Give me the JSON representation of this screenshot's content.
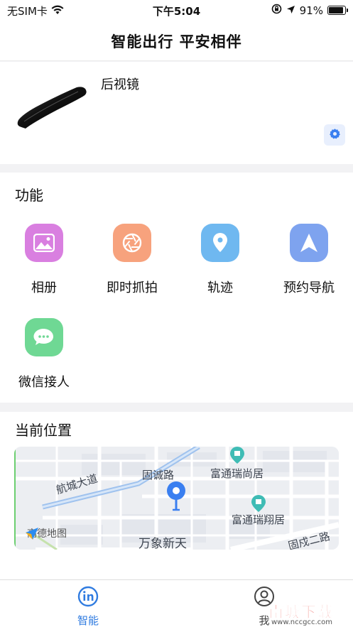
{
  "status_bar": {
    "carrier": "无SIM卡",
    "time": "下午5:04",
    "battery_text": "91%",
    "battery_level": 0.91
  },
  "nav": {
    "title": "智能出行 平安相伴"
  },
  "device": {
    "name": "后视镜"
  },
  "functions": {
    "title": "功能",
    "items": [
      {
        "label": "相册",
        "icon": "photo-icon",
        "color": "#d97fe0"
      },
      {
        "label": "即时抓拍",
        "icon": "shutter-icon",
        "color": "#f7a27d"
      },
      {
        "label": "轨迹",
        "icon": "location-pin-icon",
        "color": "#6fb8f0"
      },
      {
        "label": "预约导航",
        "icon": "navigation-arrow-icon",
        "color": "#7ea3ef"
      },
      {
        "label": "微信接人",
        "icon": "chat-bubble-icon",
        "color": "#6fd894"
      }
    ]
  },
  "location": {
    "title": "当前位置",
    "map": {
      "brand": "高德地图",
      "labels": {
        "hangcheng": "航城大道",
        "gucheng": "固诚路",
        "ruishang": "富通瑞尚居",
        "ruixiang": "富通瑞翔居",
        "wanxiang": "万象新天",
        "guchenger": "固戍二路"
      }
    }
  },
  "tab_bar": {
    "tabs": [
      {
        "label": "智能",
        "icon": "smart-tab-icon",
        "active": true,
        "color": "#2f7be0"
      },
      {
        "label": "我",
        "icon": "profile-icon",
        "active": false
      }
    ]
  },
  "watermark": {
    "main": "南城下载",
    "sub": "www.nccgcc.com"
  }
}
